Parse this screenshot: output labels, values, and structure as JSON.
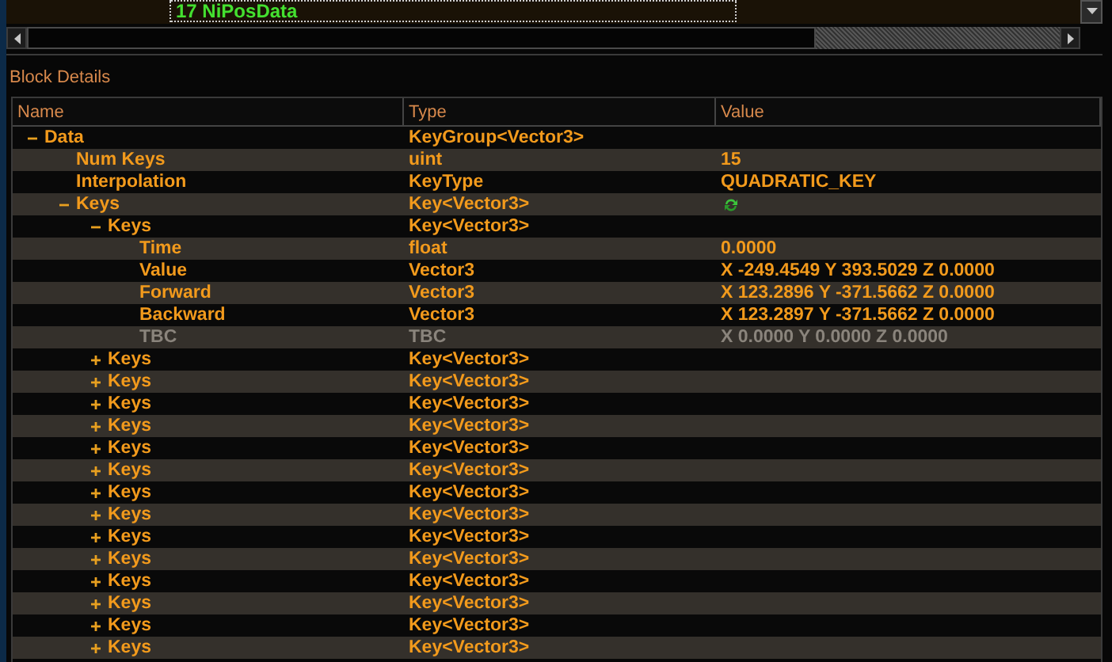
{
  "top_list": {
    "items": [
      {
        "label": "17 NiPosData",
        "selected": true
      }
    ]
  },
  "panel": {
    "title": "Block Details"
  },
  "table": {
    "columns": [
      "Name",
      "Type",
      "Value"
    ],
    "tree": [
      {
        "name": "Data",
        "type": "KeyGroup<Vector3>",
        "expanded": true,
        "children": [
          {
            "name": "Num Keys",
            "type": "uint",
            "value": "15"
          },
          {
            "name": "Interpolation",
            "type": "KeyType",
            "value": "QUADRATIC_KEY"
          },
          {
            "name": "Keys",
            "type": "Key<Vector3>",
            "expanded": true,
            "children": [
              {
                "name": "Keys",
                "type": "Key<Vector3>",
                "expanded": true,
                "children": [
                  {
                    "name": "Time",
                    "type": "float",
                    "value": "0.0000",
                    "disabled": false
                  },
                  {
                    "name": "Value",
                    "type": "Vector3",
                    "value": "X -249.4549 Y 393.5029 Z 0.0000",
                    "disabled": false
                  },
                  {
                    "name": "Forward",
                    "type": "Vector3",
                    "value": "X 123.2896 Y -371.5662 Z 0.0000",
                    "disabled": false
                  },
                  {
                    "name": "Backward",
                    "type": "Vector3",
                    "value": "X 123.2897 Y -371.5662 Z 0.0000",
                    "disabled": false
                  },
                  {
                    "name": "TBC",
                    "type": "TBC",
                    "value": "X 0.0000 Y 0.0000 Z 0.0000",
                    "disabled": true
                  }
                ]
              },
              {
                "name": "Keys",
                "type": "Key<Vector3>",
                "expanded": false
              },
              {
                "name": "Keys",
                "type": "Key<Vector3>",
                "expanded": false
              },
              {
                "name": "Keys",
                "type": "Key<Vector3>",
                "expanded": false
              },
              {
                "name": "Keys",
                "type": "Key<Vector3>",
                "expanded": false
              },
              {
                "name": "Keys",
                "type": "Key<Vector3>",
                "expanded": false
              },
              {
                "name": "Keys",
                "type": "Key<Vector3>",
                "expanded": false
              },
              {
                "name": "Keys",
                "type": "Key<Vector3>",
                "expanded": false
              },
              {
                "name": "Keys",
                "type": "Key<Vector3>",
                "expanded": false
              },
              {
                "name": "Keys",
                "type": "Key<Vector3>",
                "expanded": false
              },
              {
                "name": "Keys",
                "type": "Key<Vector3>",
                "expanded": false
              },
              {
                "name": "Keys",
                "type": "Key<Vector3>",
                "expanded": false
              },
              {
                "name": "Keys",
                "type": "Key<Vector3>",
                "expanded": false
              },
              {
                "name": "Keys",
                "type": "Key<Vector3>",
                "expanded": false
              },
              {
                "name": "Keys",
                "type": "Key<Vector3>",
                "expanded": false
              }
            ]
          }
        ]
      }
    ]
  }
}
